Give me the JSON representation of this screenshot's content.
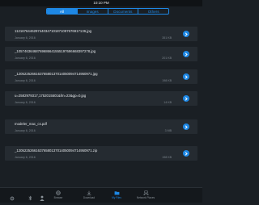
{
  "status_bar": {
    "time": "10:10 PM"
  },
  "tabs": [
    {
      "label": "All",
      "active": true
    },
    {
      "label": "Images",
      "active": false
    },
    {
      "label": "Documents",
      "active": false
    },
    {
      "label": "Others",
      "active": false
    }
  ],
  "files": [
    {
      "name": "1121676446297440347101871097676917136.jpg",
      "date": "January 6, 2016",
      "size": "351 KB"
    },
    {
      "name": "_10574636468769686641555197696668397278.jpg",
      "date": "January 6, 2016",
      "size": "201 KB"
    },
    {
      "name": "_120522526616376580137014050094714950971.jpg",
      "date": "January 6, 2016",
      "size": "198 KB"
    },
    {
      "name": "u=2582979317,1752015501&fm=23&gp=0.jpg",
      "date": "January 6, 2016",
      "size": "14 KB"
    },
    {
      "name": "modeler_mac_cs.pdf",
      "date": "January 6, 2016",
      "size": "3 MB"
    },
    {
      "name": "_120522526616376580137014050094714950971.zip",
      "date": "January 6, 2016",
      "size": "198 KB"
    }
  ],
  "bottom_nav": [
    {
      "label": "Browse",
      "icon": "globe-icon",
      "active": false
    },
    {
      "label": "Download",
      "icon": "download-icon",
      "active": false
    },
    {
      "label": "My Files",
      "icon": "folder-icon",
      "active": true
    },
    {
      "label": "Network Places",
      "icon": "network-icon",
      "active": false
    }
  ],
  "colors": {
    "accent": "#1e88e5",
    "background": "#1a1f24",
    "card": "#252b31"
  }
}
